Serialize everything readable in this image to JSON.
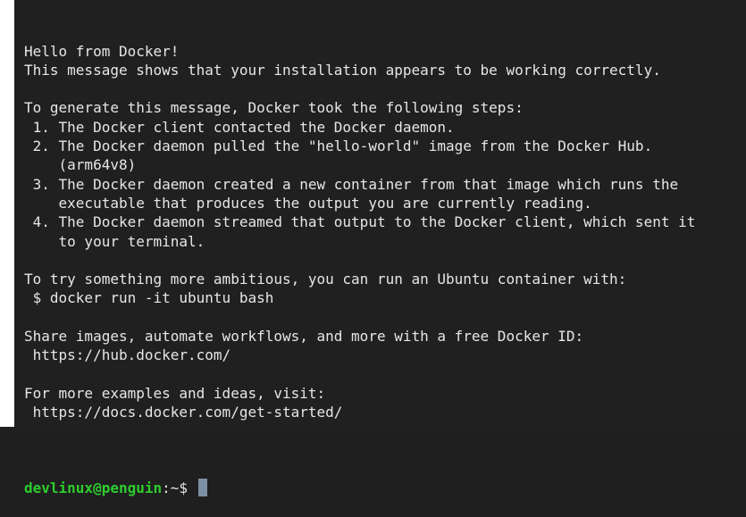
{
  "terminal": {
    "lines": [
      "Hello from Docker!",
      "This message shows that your installation appears to be working correctly.",
      "",
      "To generate this message, Docker took the following steps:",
      " 1. The Docker client contacted the Docker daemon.",
      " 2. The Docker daemon pulled the \"hello-world\" image from the Docker Hub.",
      "    (arm64v8)",
      " 3. The Docker daemon created a new container from that image which runs the",
      "    executable that produces the output you are currently reading.",
      " 4. The Docker daemon streamed that output to the Docker client, which sent it",
      "    to your terminal.",
      "",
      "To try something more ambitious, you can run an Ubuntu container with:",
      " $ docker run -it ubuntu bash",
      "",
      "Share images, automate workflows, and more with a free Docker ID:",
      " https://hub.docker.com/",
      "",
      "For more examples and ideas, visit:",
      " https://docs.docker.com/get-started/",
      ""
    ],
    "prompt": {
      "user_host": "devlinux@penguin",
      "path_symbol": ":~$ "
    }
  },
  "colors": {
    "background": "#202020",
    "text": "#e6e6e6",
    "prompt_user": "#2ecc2e",
    "cursor": "#7d8fa3"
  }
}
